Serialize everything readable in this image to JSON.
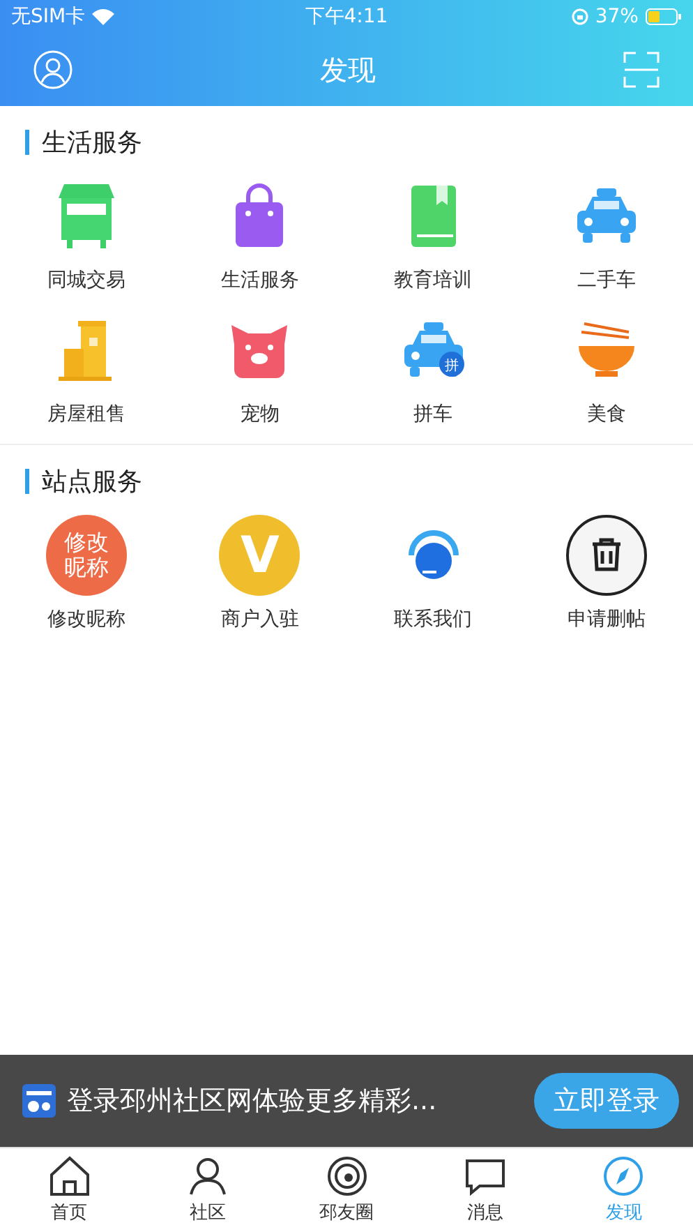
{
  "status_bar": {
    "carrier": "无SIM卡",
    "time": "下午4:11",
    "battery": "37%"
  },
  "nav": {
    "title": "发现"
  },
  "sections": [
    {
      "title": "生活服务",
      "items": [
        {
          "label": "同城交易",
          "kind": "stall"
        },
        {
          "label": "生活服务",
          "kind": "bag"
        },
        {
          "label": "教育培训",
          "kind": "book"
        },
        {
          "label": "二手车",
          "kind": "taxi"
        },
        {
          "label": "房屋租售",
          "kind": "building"
        },
        {
          "label": "宠物",
          "kind": "pig"
        },
        {
          "label": "拼车",
          "kind": "carpool",
          "icon_text": "拼"
        },
        {
          "label": "美食",
          "kind": "bowl"
        }
      ]
    },
    {
      "title": "站点服务",
      "items": [
        {
          "label": "修改昵称",
          "kind": "text_circle",
          "icon_text": "修改昵称"
        },
        {
          "label": "商户入驻",
          "kind": "letter_circle",
          "icon_text": "V"
        },
        {
          "label": "联系我们",
          "kind": "headset"
        },
        {
          "label": "申请删帖",
          "kind": "trash"
        }
      ]
    }
  ],
  "banner": {
    "text": "登录邳州社区网体验更多精彩...",
    "button": "立即登录"
  },
  "tabs": [
    {
      "label": "首页",
      "selected": false
    },
    {
      "label": "社区",
      "selected": false
    },
    {
      "label": "邳友圈",
      "selected": false
    },
    {
      "label": "消息",
      "selected": false
    },
    {
      "label": "发现",
      "selected": true
    }
  ]
}
